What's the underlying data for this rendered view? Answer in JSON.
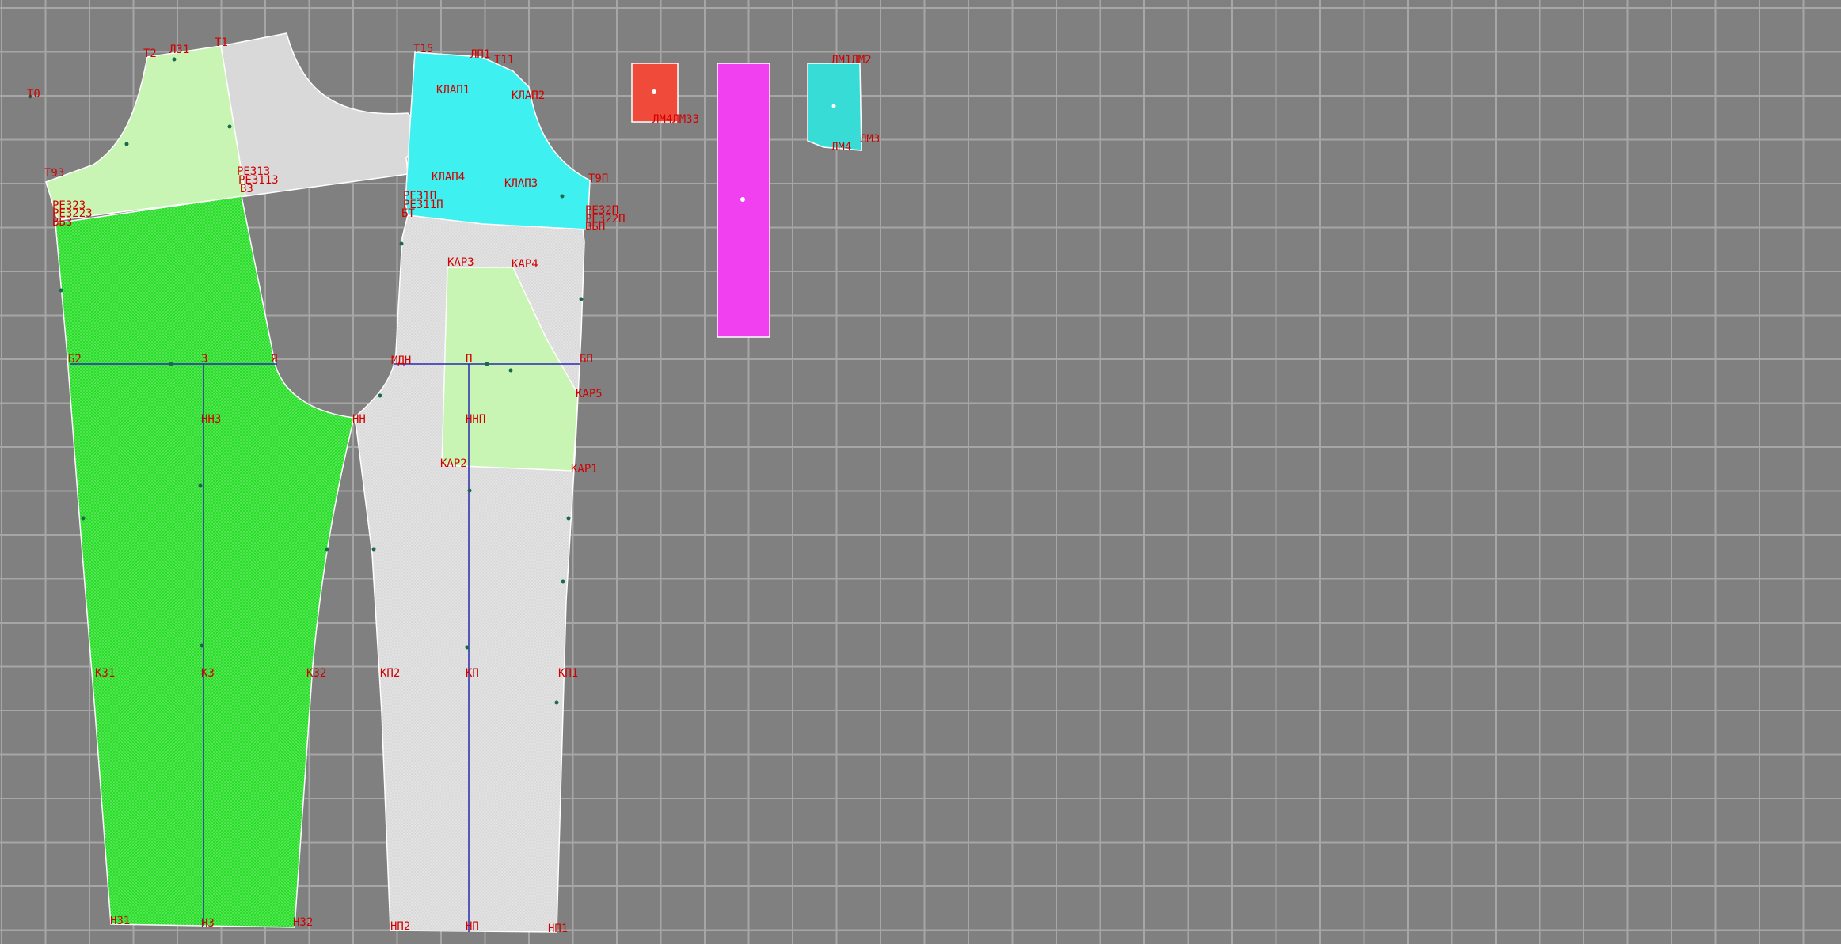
{
  "colors": {
    "background": "#808080",
    "grid": "#a6a6a6",
    "label": "#d00000",
    "grey_piece": "#d9d9d9",
    "green_piece": "#22dd22",
    "light_green_piece": "#c8f5b4",
    "cyan_piece": "#3ff0f0",
    "red_piece": "#f04b3a",
    "magenta_piece": "#f040f0",
    "teal_piece": "#38dcd6"
  },
  "labels": {
    "t0": "Т0",
    "t2": "Т2",
    "l31": "Л31",
    "t1": "Т1",
    "t15": "Т15",
    "lp1": "ЛП1",
    "t11": "Т11",
    "klap1": "КЛАП1",
    "klap2": "КЛАП2",
    "klap3": "КЛАП3",
    "klap4": "КЛАП4",
    "t93": "Т93",
    "re313": "РЕ313",
    "re3113": "РЕ3113",
    "b3": "В3",
    "re323": "РЕ323",
    "re3223": "РЕ3223",
    "vb3": "ВБ3",
    "re31p": "РЕ31П",
    "re311p": "РЕ311П",
    "bt": "БТ",
    "t9p": "Т9П",
    "re32p": "РЕ32П",
    "re322p": "РЕ322П",
    "vbp": "ВБП",
    "kar3": "КАР3",
    "kar4": "КАР4",
    "kar5": "КАР5",
    "kar2": "КАР2",
    "kar1": "КАР1",
    "b2": "Б2",
    "z": "З",
    "ya": "Я",
    "mdn": "МДН",
    "p": "П",
    "bp": "БП",
    "nn3": "НН3",
    "nn": "НН",
    "nnp": "ННП",
    "kz1": "КЗ1",
    "kz": "КЗ",
    "kz2": "КЗ2",
    "kp2": "КП2",
    "kp": "КП",
    "kp1": "КП1",
    "nz1": "НЗ1",
    "nz": "НЗ",
    "nz2": "НЗ2",
    "np2": "НП2",
    "np": "НП",
    "np1": "НП1",
    "lm4m33": "ЛМ4ЛМ33",
    "lm1lm2": "ЛМ1ЛМ2",
    "lm3": "ЛМ3",
    "lm4": "ЛМ4"
  }
}
